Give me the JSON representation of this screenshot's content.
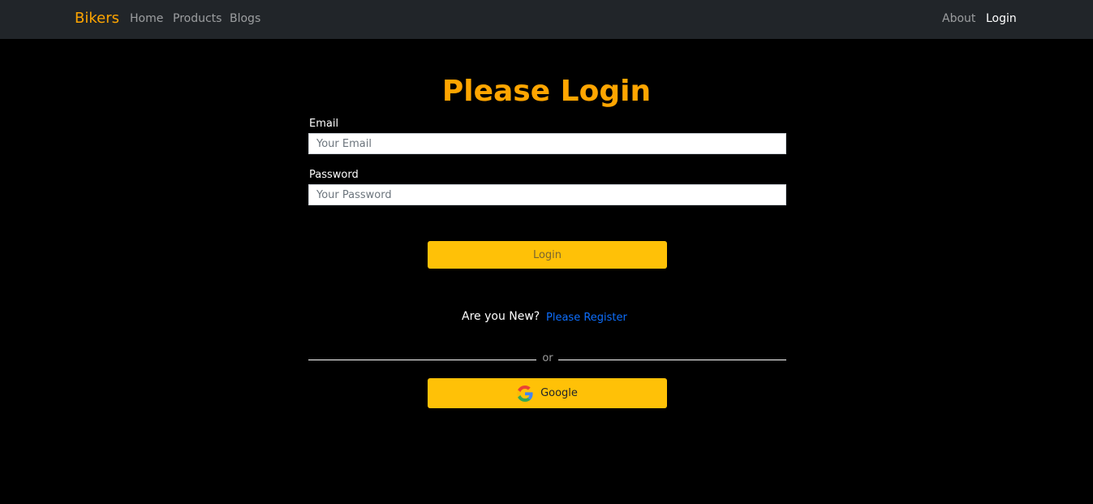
{
  "nav": {
    "brand": "Bikers",
    "left_links": [
      "Home",
      "Products",
      "Blogs"
    ],
    "right_links": [
      "About",
      "Login"
    ],
    "active": "Login"
  },
  "main": {
    "title": "Please Login",
    "email": {
      "label": "Email",
      "placeholder": "Your Email",
      "value": ""
    },
    "password": {
      "label": "Password",
      "placeholder": "Your Password",
      "value": ""
    },
    "login_button": "Login",
    "new_prompt": "Are you New?",
    "register_link": "Please Register",
    "divider_text": "or",
    "google_button": "Google",
    "google_icon": "google-logo-icon"
  },
  "colors": {
    "accent": "#ffa500",
    "button": "#ffc107",
    "navbar": "#212529",
    "link": "#0d6efd",
    "background": "#000000"
  }
}
